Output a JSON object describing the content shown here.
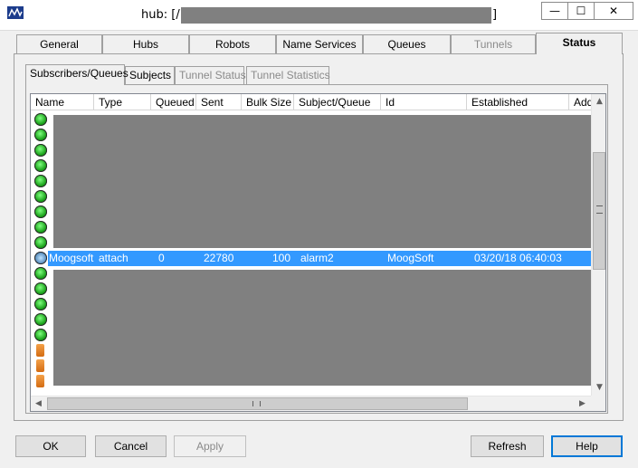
{
  "window": {
    "title_prefix": "hub: [/",
    "title_suffix": "]",
    "minimize_glyph": "—",
    "maximize_glyph": "☐",
    "close_glyph": "✕"
  },
  "main_tabs": [
    {
      "label": "General",
      "state": "normal"
    },
    {
      "label": "Hubs",
      "state": "normal"
    },
    {
      "label": "Robots",
      "state": "normal"
    },
    {
      "label": "Name Services",
      "state": "normal"
    },
    {
      "label": "Queues",
      "state": "normal"
    },
    {
      "label": "Tunnels",
      "state": "disabled"
    },
    {
      "label": "Status",
      "state": "active"
    }
  ],
  "sub_tabs": [
    {
      "label": "Subscribers/Queues",
      "state": "active"
    },
    {
      "label": "Subjects",
      "state": "normal"
    },
    {
      "label": "Tunnel Status",
      "state": "disabled"
    },
    {
      "label": "Tunnel Statistics",
      "state": "disabled"
    }
  ],
  "list": {
    "columns": [
      "Name",
      "Type",
      "Queued",
      "Sent",
      "Bulk Size",
      "Subject/Queue",
      "Id",
      "Established",
      "Add"
    ],
    "selected_row": {
      "name": "Moogsoft",
      "type": "attach",
      "queued": "0",
      "sent": "22780",
      "bulk_size": "100",
      "subject_queue": "alarm2",
      "id": "MoogSoft",
      "established": "03/20/18 06:40:03"
    },
    "vscroll": {
      "up_glyph": "▲",
      "down_glyph": "▼"
    },
    "hscroll": {
      "left_glyph": "◀",
      "right_glyph": "▶"
    }
  },
  "buttons": {
    "ok": "OK",
    "cancel": "Cancel",
    "apply": "Apply",
    "refresh": "Refresh",
    "help": "Help"
  },
  "colors": {
    "selection": "#3399ff",
    "redaction": "#808080"
  }
}
